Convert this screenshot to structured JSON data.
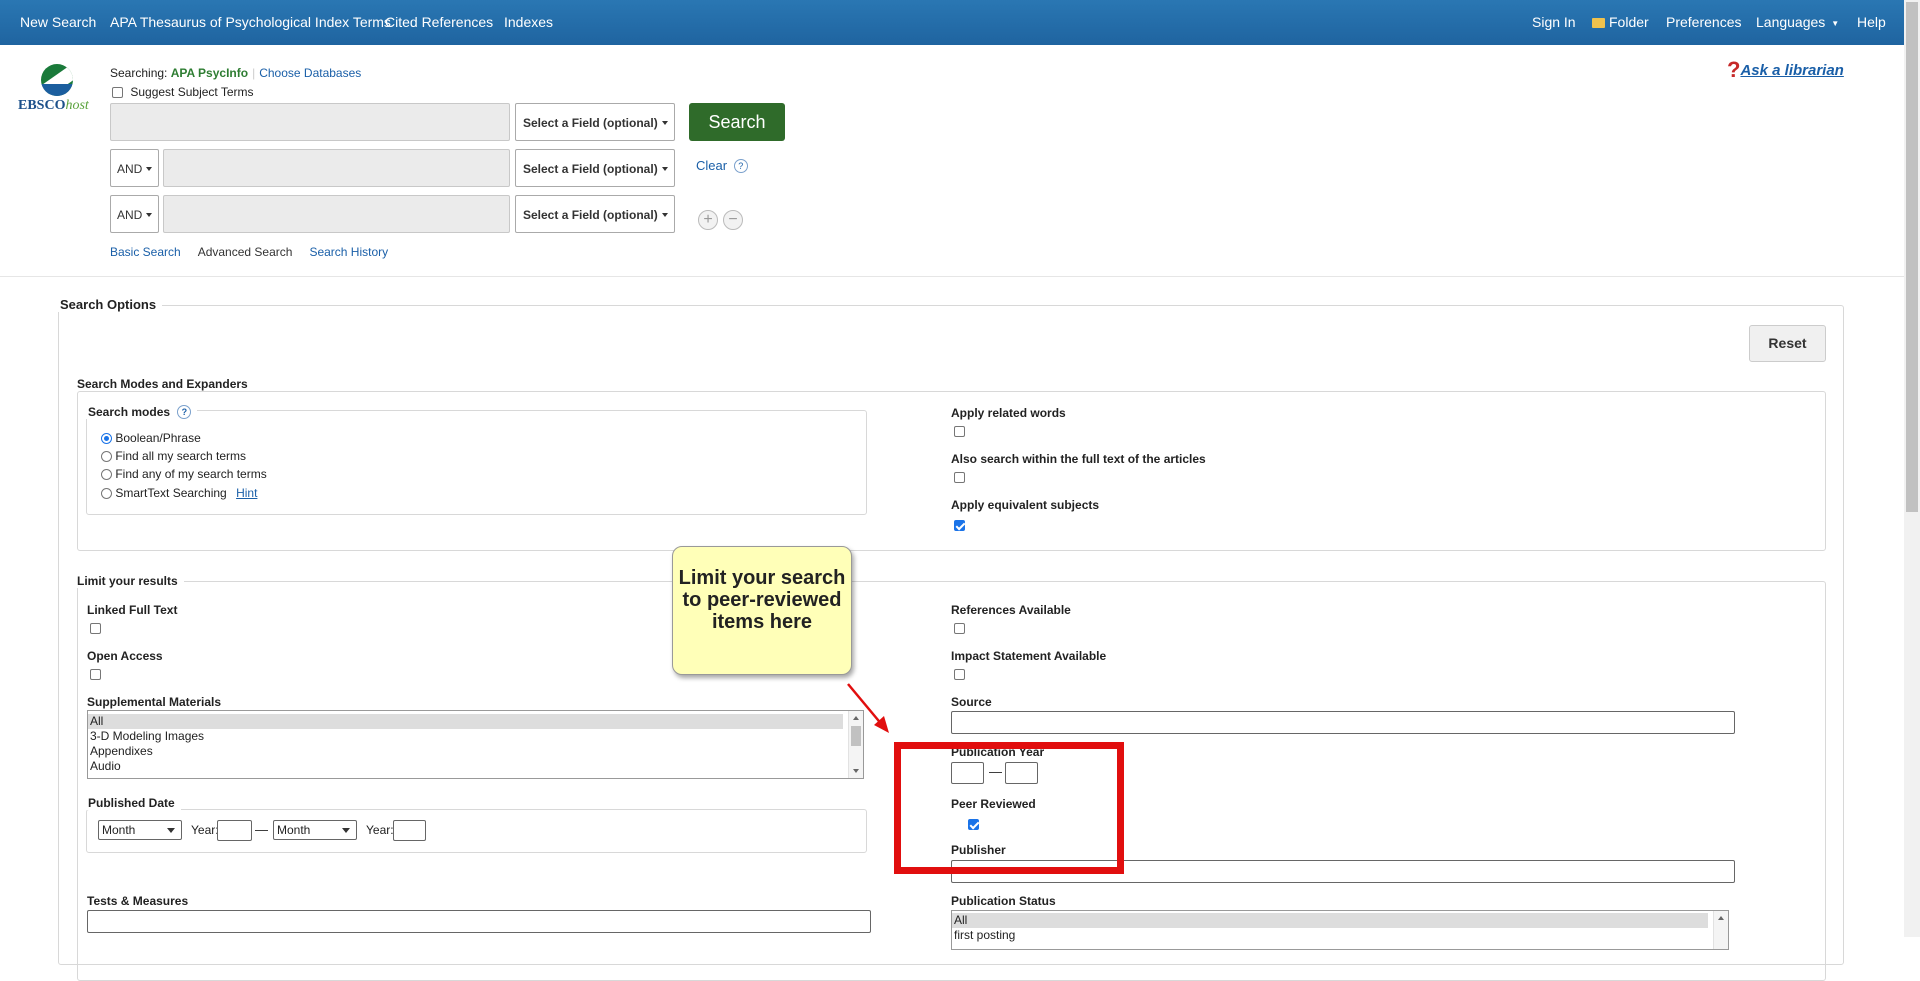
{
  "topnav": {
    "left": [
      "New Search",
      "APA Thesaurus of Psychological Index Terms",
      "Cited References",
      "Indexes"
    ],
    "sign_in": "Sign In",
    "folder": "Folder",
    "preferences": "Preferences",
    "languages": "Languages",
    "help": "Help"
  },
  "logo": {
    "main": "EBSCO",
    "accent": "host"
  },
  "searching": {
    "prefix": "Searching:",
    "database": "APA PsycInfo",
    "choose": "Choose Databases"
  },
  "suggest_subject_terms": {
    "label": "Suggest Subject Terms",
    "checked": false
  },
  "search_rows": [
    {
      "operator": "",
      "value": "",
      "field": "Select a Field (optional)"
    },
    {
      "operator": "AND",
      "value": "",
      "field": "Select a Field (optional)"
    },
    {
      "operator": "AND",
      "value": "",
      "field": "Select a Field (optional)"
    }
  ],
  "search_button": "Search",
  "clear": "Clear",
  "help_glyph": "?",
  "add_row": "+",
  "remove_row": "−",
  "ask_librarian": {
    "mark": "?",
    "label": "Ask a librarian"
  },
  "tabs": [
    "Basic Search",
    "Advanced Search",
    "Search History"
  ],
  "search_options": {
    "title": "Search Options",
    "reset": "Reset",
    "modes_expanders": {
      "title": "Search Modes and Expanders",
      "search_modes_label": "Search modes",
      "modes": [
        {
          "label": "Boolean/Phrase",
          "checked": true
        },
        {
          "label": "Find all my search terms",
          "checked": false
        },
        {
          "label": "Find any of my search terms",
          "checked": false
        },
        {
          "label": "SmartText Searching",
          "checked": false
        }
      ],
      "hint": "Hint",
      "expanders": [
        {
          "label": "Apply related words",
          "checked": false
        },
        {
          "label": "Also search within the full text of the articles",
          "checked": false
        },
        {
          "label": "Apply equivalent subjects",
          "checked": true
        }
      ]
    },
    "limit": {
      "title": "Limit your results",
      "linked_full_text": "Linked Full Text",
      "open_access": "Open Access",
      "supplemental_materials": "Supplemental Materials",
      "supplemental_options": [
        "All",
        "3-D Modeling Images",
        "Appendixes",
        "Audio"
      ],
      "published_date": "Published Date",
      "month": "Month",
      "year": "Year:",
      "tests_measures": "Tests & Measures",
      "references_available": "References Available",
      "impact_statement": "Impact Statement Available",
      "source": "Source",
      "publication_year": "Publication Year",
      "year_dash": "—",
      "peer_reviewed": {
        "label": "Peer Reviewed",
        "checked": true
      },
      "publisher": "Publisher",
      "publication_status": "Publication Status",
      "publication_status_options": [
        "All",
        "first posting"
      ]
    }
  },
  "callout": {
    "text": "Limit your search to peer-reviewed items here"
  },
  "colors": {
    "topbar": "#2a77b3",
    "search_button": "#2f6b2a",
    "highlight": "#e10e0e",
    "callout_bg": "#ffffb8",
    "link": "#1a5fa8"
  }
}
